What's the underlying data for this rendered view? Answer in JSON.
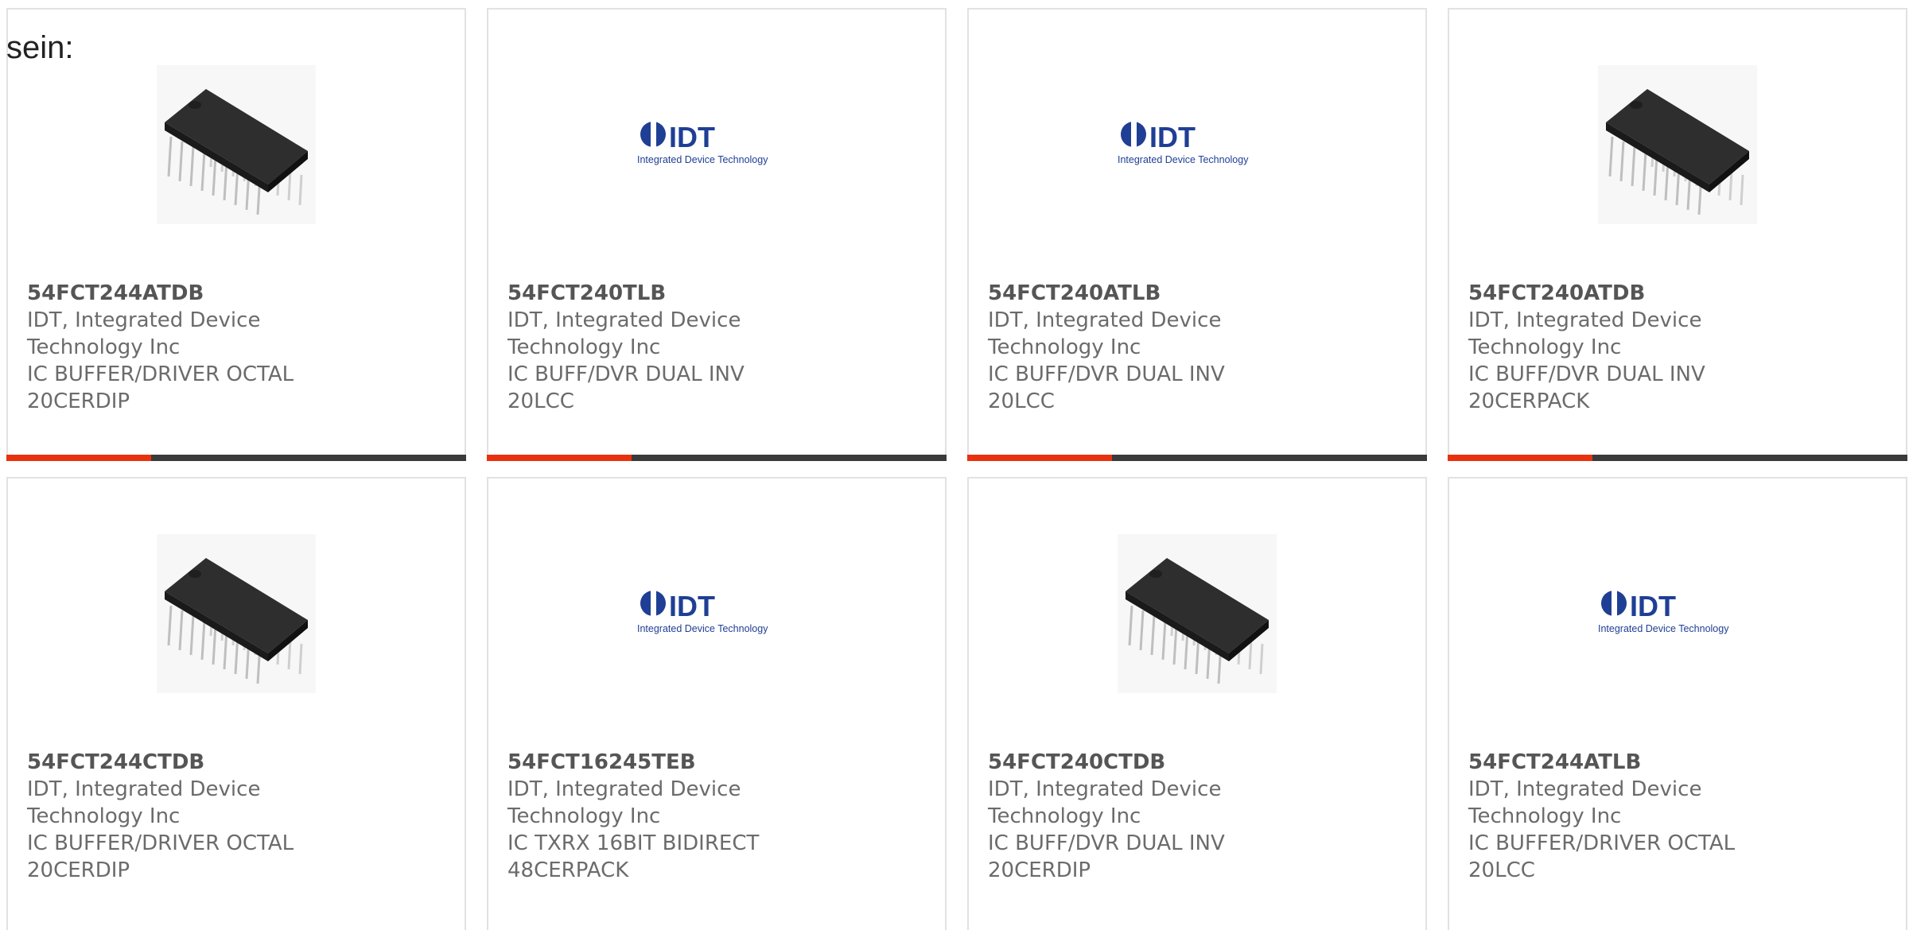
{
  "intro_text": "sein:",
  "colors": {
    "accent": "#e8320f",
    "bar": "#3a3a3a",
    "idt_blue": "#1f3f95"
  },
  "products": [
    {
      "part": "54FCT244ATDB",
      "manufacturer": "IDT, Integrated Device Technology Inc",
      "description": "IC BUFFER/DRIVER OCTAL 20CERDIP",
      "image": "chip-icon"
    },
    {
      "part": "54FCT240TLB",
      "manufacturer": "IDT, Integrated Device Technology Inc",
      "description": "IC BUFF/DVR DUAL INV 20LCC",
      "image": "idt-logo",
      "logo": {
        "mark": "IDT",
        "tagline": "Integrated Device Technology"
      }
    },
    {
      "part": "54FCT240ATLB",
      "manufacturer": "IDT, Integrated Device Technology Inc",
      "description": "IC BUFF/DVR DUAL INV 20LCC",
      "image": "idt-logo",
      "logo": {
        "mark": "IDT",
        "tagline": "Integrated Device Technology"
      }
    },
    {
      "part": "54FCT240ATDB",
      "manufacturer": "IDT, Integrated Device Technology Inc",
      "description": "IC BUFF/DVR DUAL INV 20CERPACK",
      "image": "chip-icon"
    },
    {
      "part": "54FCT244CTDB",
      "manufacturer": "IDT, Integrated Device Technology Inc",
      "description": "IC BUFFER/DRIVER OCTAL 20CERDIP",
      "image": "chip-icon"
    },
    {
      "part": "54FCT16245TEB",
      "manufacturer": "IDT, Integrated Device Technology Inc",
      "description": "IC TXRX 16BIT BIDIRECT 48CERPACK",
      "image": "idt-logo",
      "logo": {
        "mark": "IDT",
        "tagline": "Integrated Device Technology"
      }
    },
    {
      "part": "54FCT240CTDB",
      "manufacturer": "IDT, Integrated Device Technology Inc",
      "description": "IC BUFF/DVR DUAL INV 20CERDIP",
      "image": "chip-icon"
    },
    {
      "part": "54FCT244ATLB",
      "manufacturer": "IDT, Integrated Device Technology Inc",
      "description": "IC BUFFER/DRIVER OCTAL 20LCC",
      "image": "idt-logo",
      "logo": {
        "mark": "IDT",
        "tagline": "Integrated Device Technology"
      }
    }
  ]
}
